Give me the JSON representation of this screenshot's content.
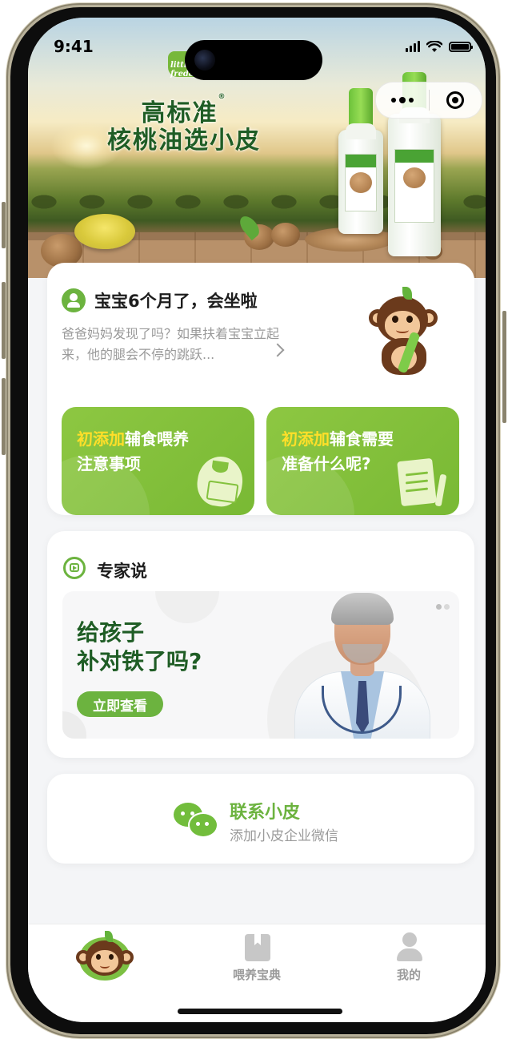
{
  "status_bar": {
    "time": "9:41"
  },
  "banner": {
    "brand_logo": "little freddie",
    "title_line1": "高标准",
    "title_line2": "核桃油选小皮",
    "reg_mark": "®"
  },
  "capsule": {
    "more_icon": "more-dots-icon",
    "close_icon": "target-close-icon"
  },
  "baby_card": {
    "title": "宝宝6个月了，会坐啦",
    "description": "爸爸妈妈发现了吗？如果扶着宝宝立起来，他的腿会不停的跳跃...",
    "tiles": [
      {
        "highlight": "初添加",
        "line1_rest": "辅食喂养",
        "line2": "注意事项",
        "icon": "bib-icon"
      },
      {
        "highlight": "初添加",
        "line1_rest": "辅食需要",
        "line2": "准备什么呢?",
        "icon": "memo-utensils-icon"
      }
    ]
  },
  "expert": {
    "section_title": "专家说",
    "headline_line1": "给孩子",
    "headline_line2": "补对铁了吗?",
    "button_label": "立即查看"
  },
  "contact": {
    "title": "联系小皮",
    "subtitle": "添加小皮企业微信"
  },
  "tabbar": {
    "items": [
      {
        "label": "",
        "icon": "monkey-mascot-icon",
        "active": true
      },
      {
        "label": "喂养宝典",
        "icon": "book-icon",
        "active": false
      },
      {
        "label": "我的",
        "icon": "user-icon",
        "active": false
      }
    ]
  },
  "colors": {
    "accent_green": "#6cb33f",
    "tile_green": "#8dc742",
    "highlight_yellow": "#ffdf29",
    "headline_dark_green": "#1f5d25"
  }
}
